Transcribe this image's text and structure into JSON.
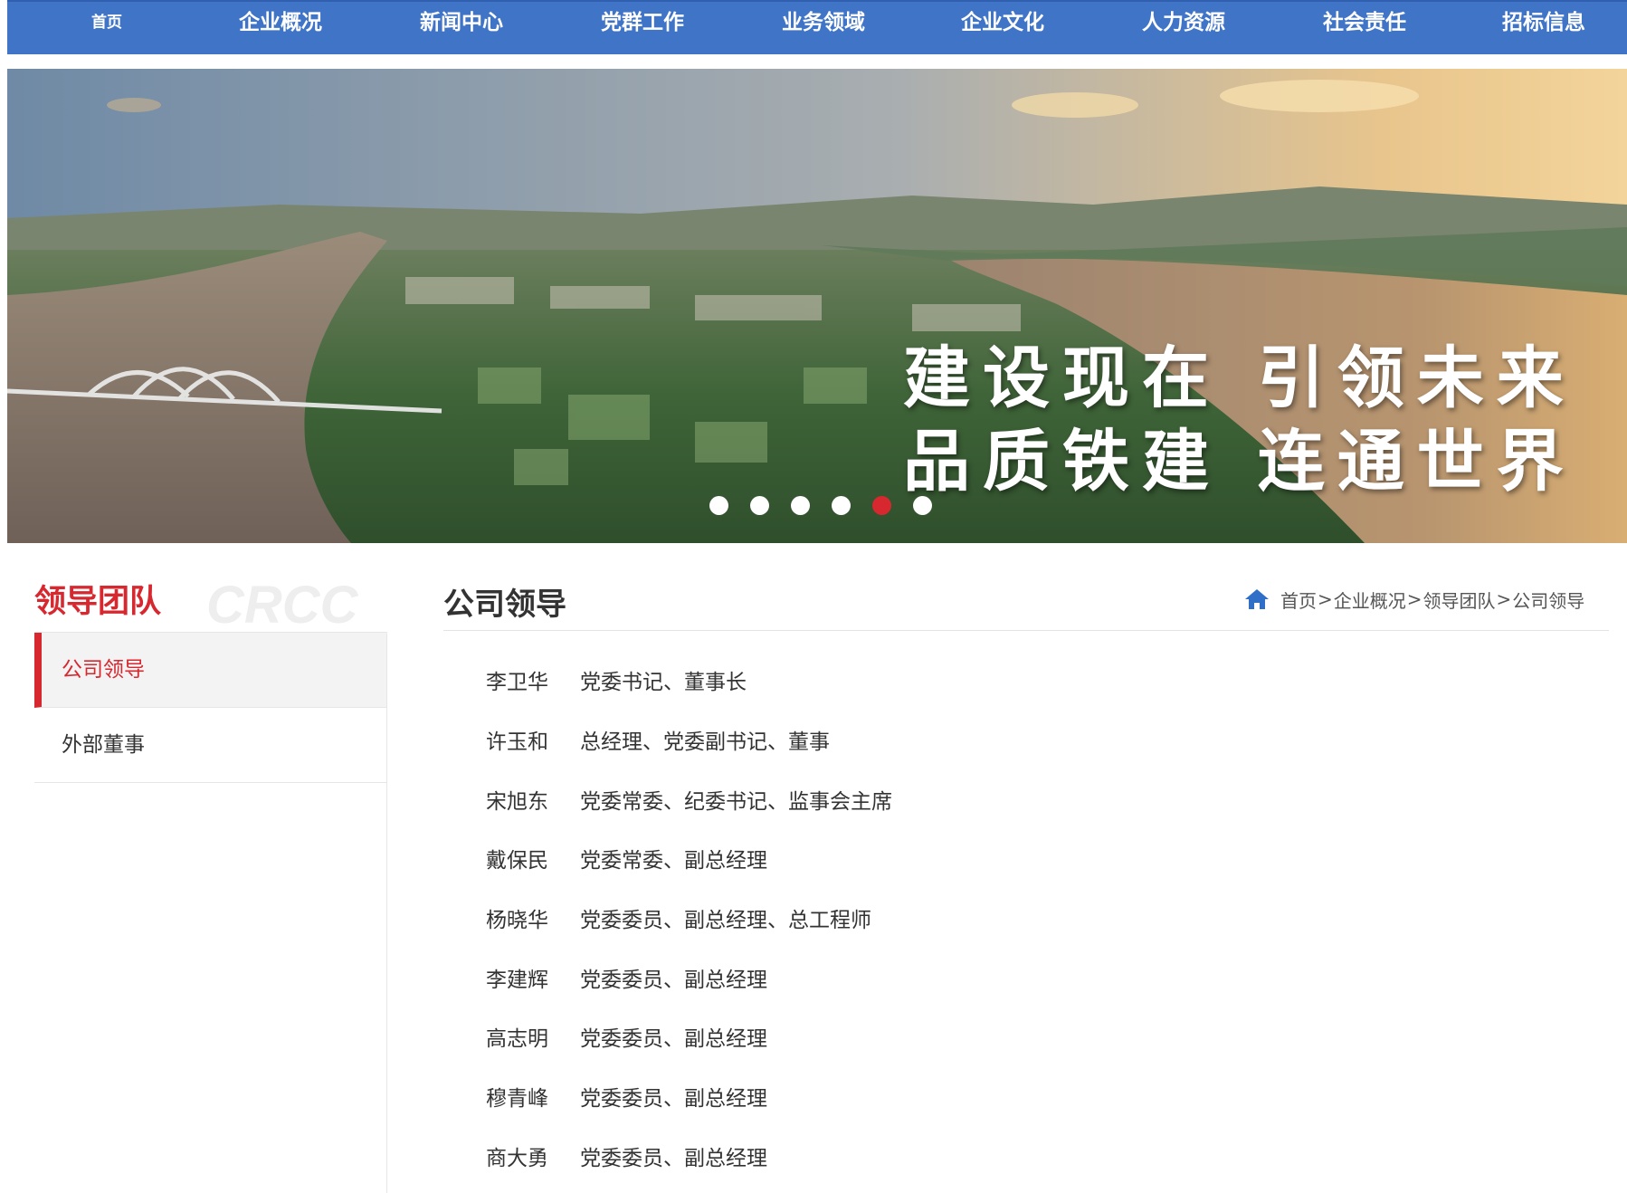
{
  "nav": {
    "items": [
      "首页",
      "企业概况",
      "新闻中心",
      "党群工作",
      "业务领域",
      "企业文化",
      "人力资源",
      "社会责任",
      "招标信息"
    ]
  },
  "banner": {
    "slogan_line1": "建设现在  引领未来",
    "slogan_line2": "品质铁建  连通世界",
    "slide_count": 6,
    "active_slide": 5
  },
  "sidebar": {
    "title": "领导团队",
    "logo_text": "CRCC",
    "items": [
      {
        "label": "公司领导",
        "active": true
      },
      {
        "label": "外部董事",
        "active": false
      }
    ]
  },
  "main": {
    "title": "公司领导",
    "breadcrumb": [
      "首页",
      "企业概况",
      "领导团队",
      "公司领导"
    ],
    "breadcrumb_separator": ">",
    "leaders": [
      {
        "name": "李卫华",
        "title": "党委书记、董事长"
      },
      {
        "name": "许玉和",
        "title": "总经理、党委副书记、董事"
      },
      {
        "name": "宋旭东",
        "title": "党委常委、纪委书记、监事会主席"
      },
      {
        "name": "戴保民",
        "title": "党委常委、副总经理"
      },
      {
        "name": "杨晓华",
        "title": "党委委员、副总经理、总工程师"
      },
      {
        "name": "李建辉",
        "title": "党委委员、副总经理"
      },
      {
        "name": "高志明",
        "title": "党委委员、副总经理"
      },
      {
        "name": "穆青峰",
        "title": "党委委员、副总经理"
      },
      {
        "name": "商大勇",
        "title": "党委委员、副总经理"
      }
    ]
  },
  "colors": {
    "nav_bg": "#3f74c7",
    "accent_red": "#d7282f",
    "home_icon_blue": "#2f6fc8"
  }
}
